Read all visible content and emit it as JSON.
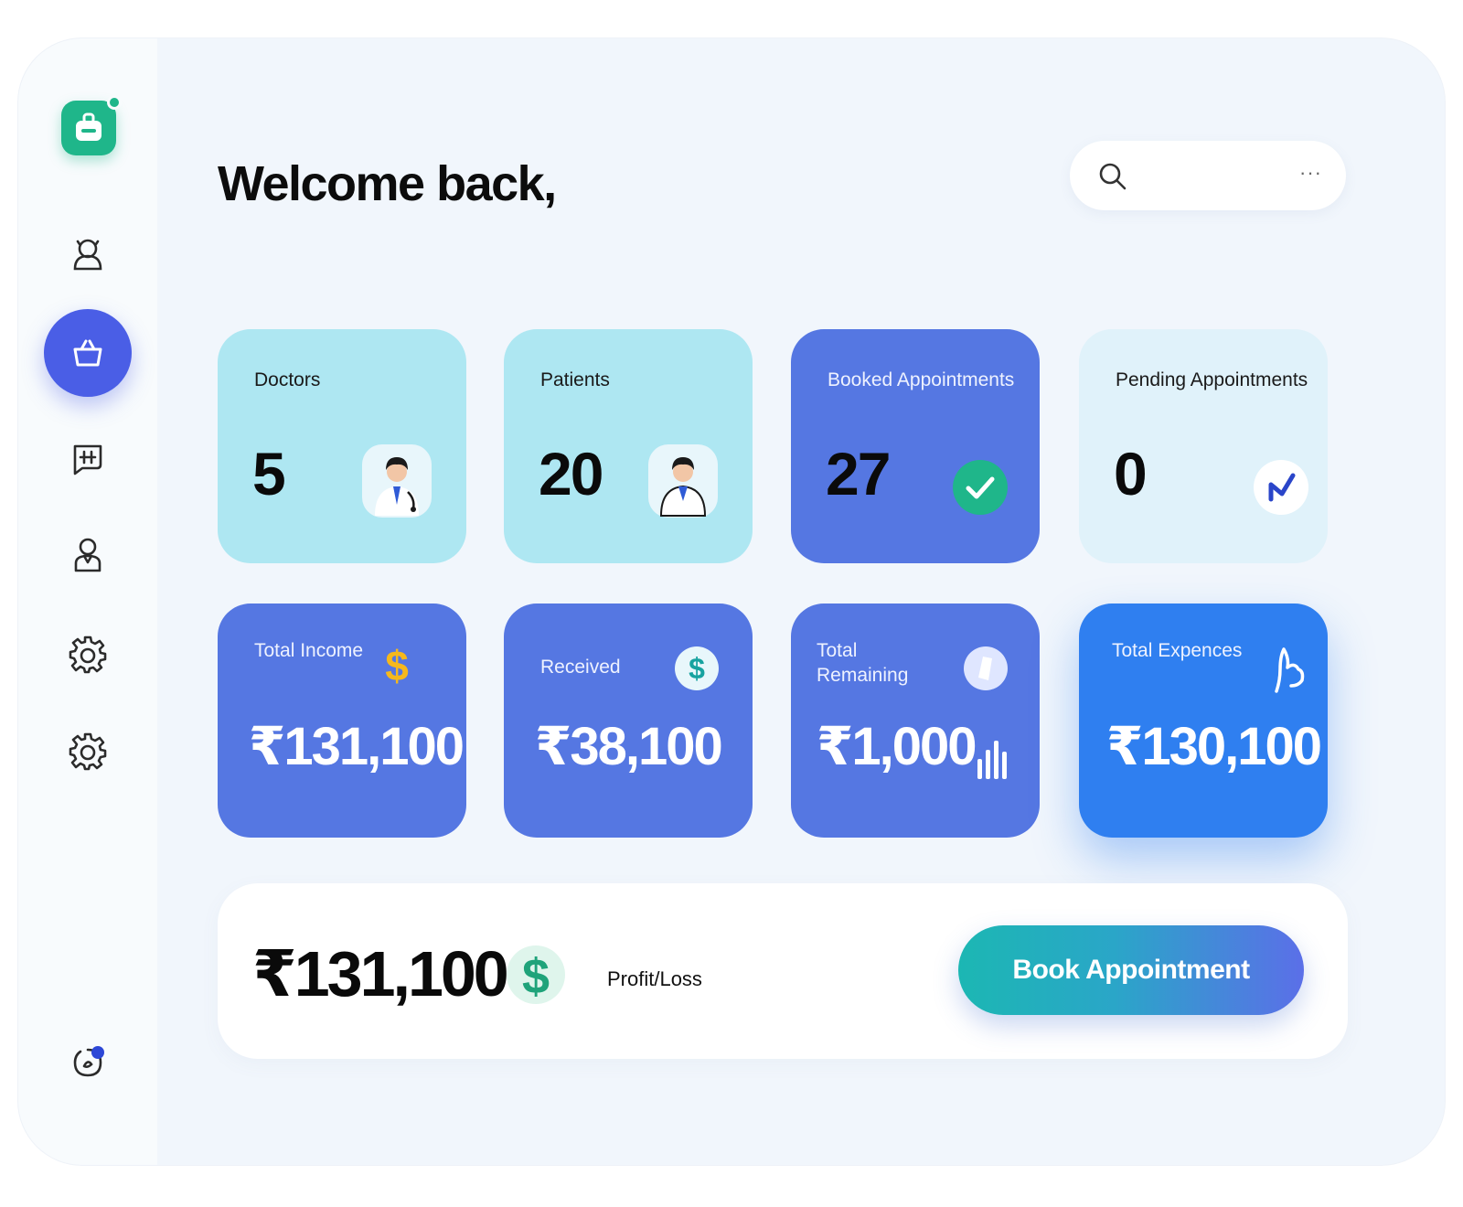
{
  "header": {
    "greeting": "Welcome back,"
  },
  "search": {
    "menu_glyph": "···"
  },
  "sidebar": {
    "items": [
      {
        "icon": "user-icon"
      },
      {
        "icon": "basket-icon",
        "active": true
      },
      {
        "icon": "chat-icon"
      },
      {
        "icon": "profile-icon"
      },
      {
        "icon": "gear-icon"
      },
      {
        "icon": "gear-icon"
      }
    ],
    "bottom_icon": "notification-icon"
  },
  "stats": {
    "doctors": {
      "label": "Doctors",
      "value": "5"
    },
    "patients": {
      "label": "Patients",
      "value": "20"
    },
    "booked": {
      "label": "Booked Appointments",
      "value": "27"
    },
    "pending": {
      "label": "Pending Appointments",
      "value": "0"
    }
  },
  "finance": {
    "total_income": {
      "label": "Total Income",
      "value": "₹131,100"
    },
    "received": {
      "label": "Received",
      "value": "₹38,100"
    },
    "total_remaining": {
      "label": "Total Remaining",
      "value": "₹1,000"
    },
    "total_expences": {
      "label": "Total Expences",
      "value": "₹130,100"
    }
  },
  "summary": {
    "amount": "₹131,100",
    "label": "Profit/Loss",
    "button_label": "Book Appointment"
  },
  "colors": {
    "accent": "#4a5ee6",
    "brand_green": "#1fb68a",
    "card_light": "#aee7f2",
    "card_blue": "#5577e2",
    "card_bright": "#2f7ff0"
  }
}
